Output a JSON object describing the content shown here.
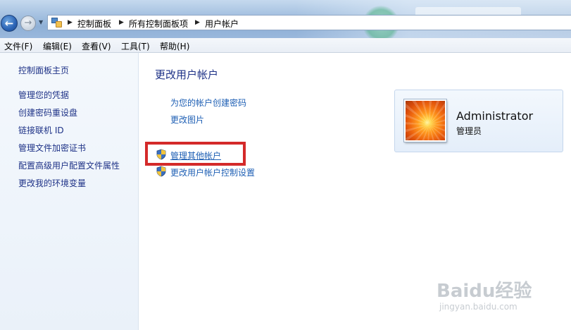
{
  "breadcrumb": {
    "items": [
      "控制面板",
      "所有控制面板项",
      "用户帐户"
    ]
  },
  "menu": {
    "items": [
      "文件(F)",
      "编辑(E)",
      "查看(V)",
      "工具(T)",
      "帮助(H)"
    ]
  },
  "sidebar": {
    "items": [
      {
        "label": "控制面板主页"
      },
      {
        "label": "管理您的凭据"
      },
      {
        "label": "创建密码重设盘"
      },
      {
        "label": "链接联机 ID"
      },
      {
        "label": "管理文件加密证书"
      },
      {
        "label": "配置高级用户配置文件属性"
      },
      {
        "label": "更改我的环境变量"
      }
    ]
  },
  "main": {
    "title": "更改用户帐户",
    "tasks": [
      {
        "label": "为您的帐户创建密码"
      },
      {
        "label": "更改图片"
      },
      {
        "label": "管理其他帐户"
      },
      {
        "label": "更改用户帐户控制设置"
      }
    ]
  },
  "user": {
    "name": "Administrator",
    "role": "管理员"
  },
  "watermark": {
    "brand": "Baidu经验",
    "url": "jingyan.baidu.com"
  },
  "colors": {
    "link": "#1e3287",
    "task_link": "#1e5fb4",
    "highlight": "#d42a2a"
  }
}
